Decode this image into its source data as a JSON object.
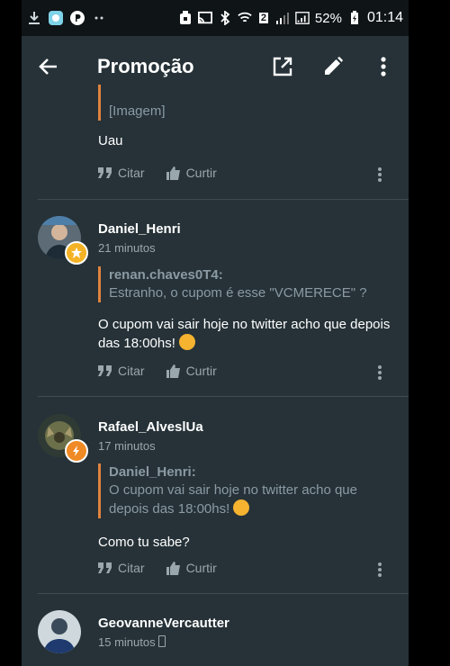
{
  "status_bar": {
    "battery_percent": "52%",
    "time": "01:14",
    "sim_badge": "2"
  },
  "toolbar": {
    "title": "Promoção",
    "icons": [
      "back-arrow-icon",
      "open-external-icon",
      "edit-pencil-icon",
      "more-vert-icon"
    ]
  },
  "posts": [
    {
      "quote_author": "",
      "quote_text": "[Imagem]",
      "message": "Uau",
      "quote_label": "Citar",
      "like_label": "Curtir"
    },
    {
      "username": "Daniel_Henri",
      "time": "21 minutos",
      "quote_author": "renan.chaves0T4:",
      "quote_text": "Estranho, o cupom é esse \"VCMERECE\" ?",
      "message": "O cupom vai sair hoje no twitter acho que depois das 18:00hs!",
      "quote_label": "Citar",
      "like_label": "Curtir"
    },
    {
      "username": "Rafael_AlveslUa",
      "time": "17 minutos",
      "quote_author": "Daniel_Henri:",
      "quote_text": "O cupom vai sair hoje no twitter acho que depois das 18:00hs!",
      "message": "Como tu sabe?",
      "quote_label": "Citar",
      "like_label": "Curtir"
    },
    {
      "username": "GeovanneVercautter",
      "time": "15 minutos"
    }
  ],
  "colors": {
    "background": "#263238",
    "quote_bar": "#e0833d",
    "badge": "#f4b325"
  }
}
